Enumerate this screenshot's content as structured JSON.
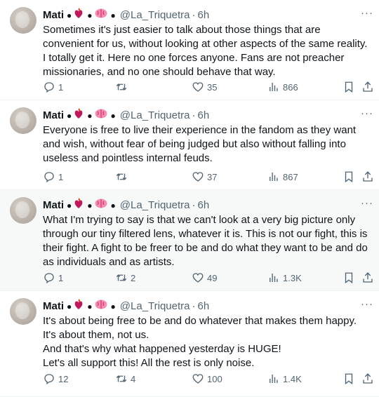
{
  "tweets": [
    {
      "author_name": "Mati",
      "handle": "@La_Triquetra",
      "time": "6h",
      "text_lines": [
        "Sometimes it's just easier to talk about those things that are convenient for us, without looking at other aspects of the same reality. I totally get it. Here no one forces anyone. Fans are not preacher missionaries, and no one should behave that way."
      ],
      "replies": "1",
      "retweets": "",
      "likes": "35",
      "views": "866"
    },
    {
      "author_name": "Mati",
      "handle": "@La_Triquetra",
      "time": "6h",
      "text_lines": [
        "Everyone is free to live their experience in the fandom as they want and wish, without fear of being judged but also without falling into useless and pointless internal feuds."
      ],
      "replies": "1",
      "retweets": "",
      "likes": "37",
      "views": "867"
    },
    {
      "author_name": "Mati",
      "handle": "@La_Triquetra",
      "time": "6h",
      "text_lines": [
        "What I'm trying to say is that we can't look at a very big picture only through our tiny filtered lens, whatever it is. This is not our fight, this is their fight. A fight to be freer to be and do what they want to be and do as individuals and as artists."
      ],
      "replies": "1",
      "retweets": "2",
      "likes": "49",
      "views": "1.3K"
    },
    {
      "author_name": "Mati",
      "handle": "@La_Triquetra",
      "time": "6h",
      "text_lines": [
        "It's about being free to be and do whatever that makes them happy. It's about them, not us.",
        "And that's why what happened yesterday is HUGE!",
        "Let's all support this! All the rest is only noise."
      ],
      "replies": "12",
      "retweets": "4",
      "likes": "100",
      "views": "1.4K"
    }
  ],
  "separator": "·",
  "more_label": "···",
  "icons": {
    "reply": "reply-icon",
    "retweet": "retweet-icon",
    "like": "heart-icon",
    "views": "views-chart-icon",
    "bookmark": "bookmark-icon",
    "share": "share-icon",
    "name_emojis": [
      "fire-heart-emoji",
      "brain-emoji"
    ]
  }
}
